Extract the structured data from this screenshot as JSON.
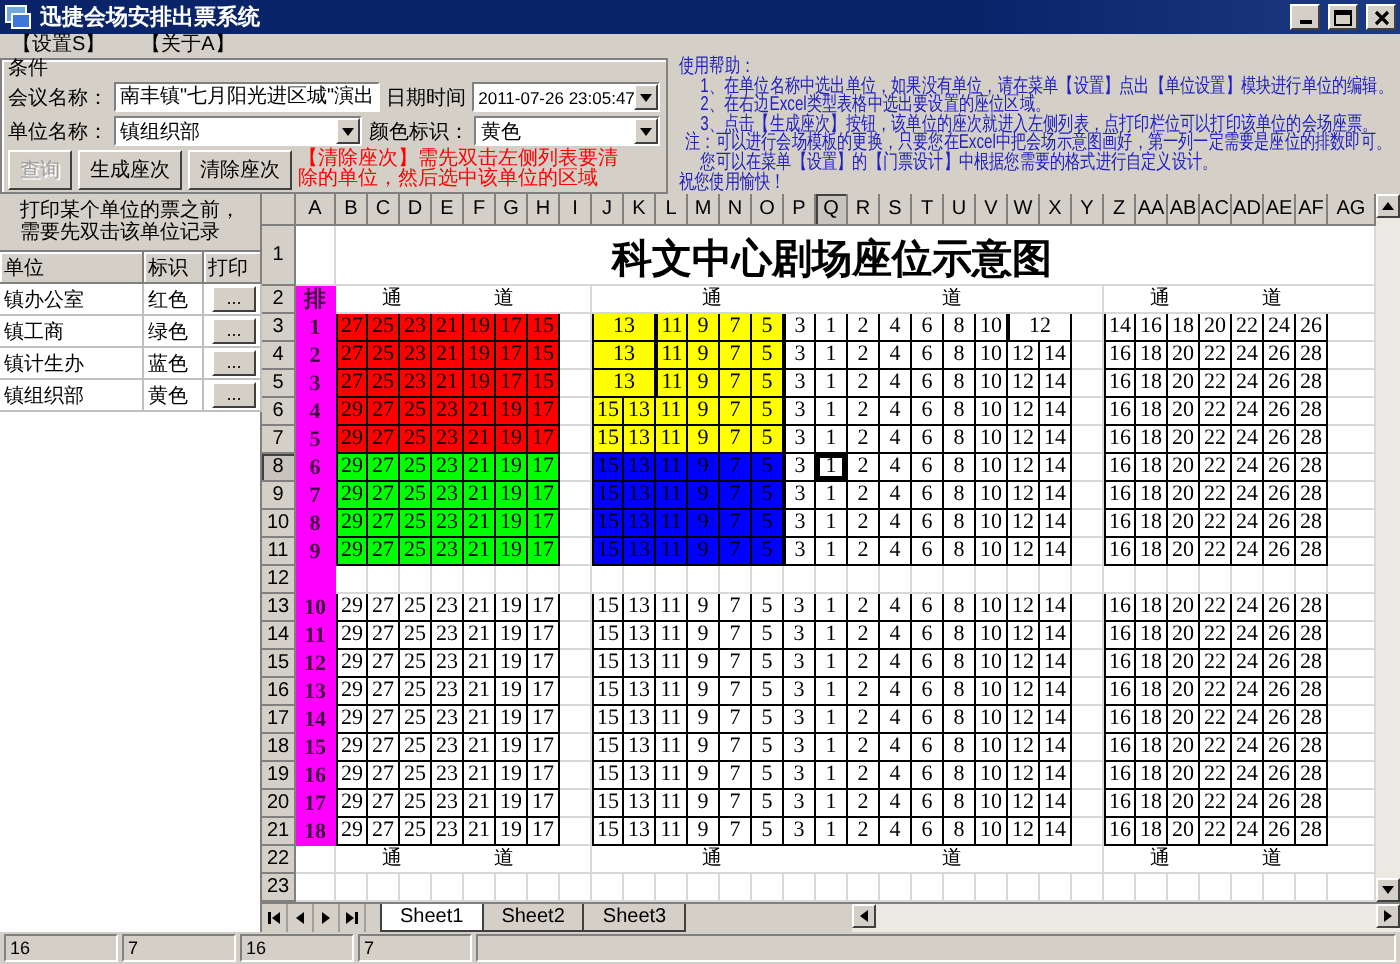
{
  "window": {
    "title": "迅捷会场安排出票系统"
  },
  "menu": [
    "【设置S】",
    "【关于A】"
  ],
  "conditions": {
    "legend": "条件",
    "meeting": {
      "label": "会议名称：",
      "value": "南丰镇\"七月阳光进区城\"演出"
    },
    "datetime": {
      "label": "日期时间",
      "value": "2011-07-26 23:05:47"
    },
    "unit": {
      "label": "单位名称：",
      "value": "镇组织部"
    },
    "color": {
      "label": "颜色标识：",
      "value": "黄色"
    },
    "buttons": [
      {
        "label": "查询",
        "disabled": true
      },
      {
        "label": "生成座次",
        "disabled": false
      },
      {
        "label": "清除座次",
        "disabled": false
      }
    ],
    "note": "【清除座次】需先双击左侧列表要清除的单位，然后选中该单位的区域"
  },
  "help": [
    "使用帮助：",
    "1、在单位名称中选出单位，如果没有单位，请在菜单【设置】点出【单位设置】模块进行单位的编辑。",
    "2、在右边Excel类型表格中选出要设置的座位区域。",
    "3、点击【生成座次】按钮，该单位的座次就进入左侧列表，点打印栏位可以打印该单位的会场座票。",
    "注：可以进行会场模板的更换，只要您在Excel中把会场示意图画好，第一列一定需要是座位的排数即可。",
    "您可以在菜单【设置】的【门票设计】中根据您需要的格式进行自定义设计。",
    "祝您使用愉快！"
  ],
  "unit_list": {
    "hint": "打印某个单位的票之前，需要先双击该单位记录",
    "columns": [
      "单位",
      "标识",
      "打印"
    ],
    "rows": [
      {
        "name": "镇办公室",
        "tag": "红色",
        "print": "..."
      },
      {
        "name": "镇工商",
        "tag": "绿色",
        "print": "..."
      },
      {
        "name": "镇计生办",
        "tag": "蓝色",
        "print": "..."
      },
      {
        "name": "镇组织部",
        "tag": "黄色",
        "print": "..."
      }
    ]
  },
  "sheet": {
    "columns": [
      {
        "label": "A",
        "selected": false
      },
      {
        "label": "B",
        "selected": false
      },
      {
        "label": "C",
        "selected": false
      },
      {
        "label": "D",
        "selected": false
      },
      {
        "label": "E",
        "selected": false
      },
      {
        "label": "F",
        "selected": false
      },
      {
        "label": "G",
        "selected": false
      },
      {
        "label": "H",
        "selected": false
      },
      {
        "label": "I",
        "selected": false
      },
      {
        "label": "J",
        "selected": false
      },
      {
        "label": "K",
        "selected": false
      },
      {
        "label": "L",
        "selected": false
      },
      {
        "label": "M",
        "selected": false
      },
      {
        "label": "N",
        "selected": false
      },
      {
        "label": "O",
        "selected": false
      },
      {
        "label": "P",
        "selected": false
      },
      {
        "label": "Q",
        "selected": true
      },
      {
        "label": "R",
        "selected": false
      },
      {
        "label": "S",
        "selected": false
      },
      {
        "label": "T",
        "selected": false
      },
      {
        "label": "U",
        "selected": false
      },
      {
        "label": "V",
        "selected": false
      },
      {
        "label": "W",
        "selected": false
      },
      {
        "label": "X",
        "selected": false
      },
      {
        "label": "Y",
        "selected": false
      },
      {
        "label": "Z",
        "selected": false
      },
      {
        "label": "AA",
        "selected": false
      },
      {
        "label": "AB",
        "selected": false
      },
      {
        "label": "AC",
        "selected": false
      },
      {
        "label": "AD",
        "selected": false
      },
      {
        "label": "AE",
        "selected": false
      },
      {
        "label": "AF",
        "selected": false
      },
      {
        "label": "AG",
        "selected": false
      }
    ],
    "rows": [
      {
        "kind": "title",
        "n": "1",
        "selected": false,
        "marked": false,
        "text": "科文中心剧场座位示意图"
      },
      {
        "kind": "aisle",
        "n": "2",
        "selected": false,
        "marked": true,
        "label": "排",
        "blocks": [
          [
            "通",
            "道"
          ],
          [
            "通",
            "道"
          ],
          [
            "通",
            "道"
          ]
        ]
      },
      {
        "kind": "seats",
        "n": "3",
        "selected": false,
        "marked": true,
        "label": "1",
        "segments": [
          {
            "kind": "seats",
            "color": "#ff0000",
            "seats": [
              "27",
              "25",
              "23",
              "21",
              "19",
              "17",
              "15"
            ]
          },
          {
            "kind": "gap"
          },
          {
            "kind": "merged",
            "color": "#ffff00",
            "seats": [
              "13"
            ]
          },
          {
            "kind": "seats",
            "color": "#ffff00",
            "seats": [
              "11",
              "9",
              "7",
              "5"
            ]
          },
          {
            "kind": "seats",
            "color": "#ffffff",
            "seats": [
              "3",
              "1",
              "2",
              "4",
              "6",
              "8",
              "10"
            ]
          },
          {
            "kind": "merged",
            "color": "#ffffff",
            "seats": [
              "12"
            ]
          },
          {
            "kind": "gap"
          },
          {
            "kind": "seats",
            "color": "#ffffff",
            "seats": [
              "14",
              "16",
              "18",
              "20",
              "22",
              "24",
              "26"
            ]
          }
        ]
      },
      {
        "kind": "seats",
        "n": "4",
        "selected": false,
        "marked": true,
        "label": "2",
        "segments": [
          {
            "kind": "seats",
            "color": "#ff0000",
            "seats": [
              "27",
              "25",
              "23",
              "21",
              "19",
              "17",
              "15"
            ]
          },
          {
            "kind": "gap"
          },
          {
            "kind": "merged",
            "color": "#ffff00",
            "seats": [
              "13"
            ]
          },
          {
            "kind": "seats",
            "color": "#ffff00",
            "seats": [
              "11",
              "9",
              "7",
              "5"
            ]
          },
          {
            "kind": "seats",
            "color": "#ffffff",
            "seats": [
              "3",
              "1",
              "2",
              "4",
              "6",
              "8",
              "10",
              "12",
              "14"
            ]
          },
          {
            "kind": "gap"
          },
          {
            "kind": "seats",
            "color": "#ffffff",
            "seats": [
              "16",
              "18",
              "20",
              "22",
              "24",
              "26",
              "28"
            ]
          }
        ]
      },
      {
        "kind": "seats",
        "n": "5",
        "selected": false,
        "marked": true,
        "label": "3",
        "segments": [
          {
            "kind": "seats",
            "color": "#ff0000",
            "seats": [
              "27",
              "25",
              "23",
              "21",
              "19",
              "17",
              "15"
            ]
          },
          {
            "kind": "gap"
          },
          {
            "kind": "merged",
            "color": "#ffff00",
            "seats": [
              "13"
            ]
          },
          {
            "kind": "seats",
            "color": "#ffff00",
            "seats": [
              "11",
              "9",
              "7",
              "5"
            ]
          },
          {
            "kind": "seats",
            "color": "#ffffff",
            "seats": [
              "3",
              "1",
              "2",
              "4",
              "6",
              "8",
              "10",
              "12",
              "14"
            ]
          },
          {
            "kind": "gap"
          },
          {
            "kind": "seats",
            "color": "#ffffff",
            "seats": [
              "16",
              "18",
              "20",
              "22",
              "24",
              "26",
              "28"
            ]
          }
        ]
      },
      {
        "kind": "seats",
        "n": "6",
        "selected": false,
        "marked": true,
        "label": "4",
        "segments": [
          {
            "kind": "seats",
            "color": "#ff0000",
            "seats": [
              "29",
              "27",
              "25",
              "23",
              "21",
              "19",
              "17"
            ]
          },
          {
            "kind": "gap"
          },
          {
            "kind": "seats",
            "color": "#ffff00",
            "seats": [
              "15",
              "13",
              "11",
              "9",
              "7",
              "5"
            ]
          },
          {
            "kind": "seats",
            "color": "#ffffff",
            "seats": [
              "3",
              "1",
              "2",
              "4",
              "6",
              "8",
              "10",
              "12",
              "14"
            ]
          },
          {
            "kind": "gap"
          },
          {
            "kind": "seats",
            "color": "#ffffff",
            "seats": [
              "16",
              "18",
              "20",
              "22",
              "24",
              "26",
              "28"
            ]
          }
        ]
      },
      {
        "kind": "seats",
        "n": "7",
        "selected": false,
        "marked": true,
        "label": "5",
        "segments": [
          {
            "kind": "seats",
            "color": "#ff0000",
            "seats": [
              "29",
              "27",
              "25",
              "23",
              "21",
              "19",
              "17"
            ]
          },
          {
            "kind": "gap"
          },
          {
            "kind": "seats",
            "color": "#ffff00",
            "seats": [
              "15",
              "13",
              "11",
              "9",
              "7",
              "5"
            ]
          },
          {
            "kind": "seats",
            "color": "#ffffff",
            "seats": [
              "3",
              "1",
              "2",
              "4",
              "6",
              "8",
              "10",
              "12",
              "14"
            ]
          },
          {
            "kind": "gap"
          },
          {
            "kind": "seats",
            "color": "#ffffff",
            "seats": [
              "16",
              "18",
              "20",
              "22",
              "24",
              "26",
              "28"
            ]
          }
        ]
      },
      {
        "kind": "seats",
        "n": "8",
        "selected": true,
        "marked": true,
        "label": "6",
        "segments": [
          {
            "kind": "seats",
            "color": "#00ff00",
            "seats": [
              "29",
              "27",
              "25",
              "23",
              "21",
              "19",
              "17"
            ]
          },
          {
            "kind": "gap"
          },
          {
            "kind": "seats",
            "color": "#0000ff",
            "seats": [
              "15",
              "13",
              "11",
              "9",
              "7",
              "5"
            ]
          },
          {
            "kind": "seats",
            "color": "#ffffff",
            "seats": [
              "3",
              "1",
              "2",
              "4",
              "6",
              "8",
              "10",
              "12",
              "14"
            ]
          },
          {
            "kind": "gap"
          },
          {
            "kind": "seats",
            "color": "#ffffff",
            "seats": [
              "16",
              "18",
              "20",
              "22",
              "24",
              "26",
              "28"
            ]
          }
        ]
      },
      {
        "kind": "seats",
        "n": "9",
        "selected": false,
        "marked": true,
        "label": "7",
        "segments": [
          {
            "kind": "seats",
            "color": "#00ff00",
            "seats": [
              "29",
              "27",
              "25",
              "23",
              "21",
              "19",
              "17"
            ]
          },
          {
            "kind": "gap"
          },
          {
            "kind": "seats",
            "color": "#0000ff",
            "seats": [
              "15",
              "13",
              "11",
              "9",
              "7",
              "5"
            ]
          },
          {
            "kind": "seats",
            "color": "#ffffff",
            "seats": [
              "3",
              "1",
              "2",
              "4",
              "6",
              "8",
              "10",
              "12",
              "14"
            ]
          },
          {
            "kind": "gap"
          },
          {
            "kind": "seats",
            "color": "#ffffff",
            "seats": [
              "16",
              "18",
              "20",
              "22",
              "24",
              "26",
              "28"
            ]
          }
        ]
      },
      {
        "kind": "seats",
        "n": "10",
        "selected": false,
        "marked": true,
        "label": "8",
        "segments": [
          {
            "kind": "seats",
            "color": "#00ff00",
            "seats": [
              "29",
              "27",
              "25",
              "23",
              "21",
              "19",
              "17"
            ]
          },
          {
            "kind": "gap"
          },
          {
            "kind": "seats",
            "color": "#0000ff",
            "seats": [
              "15",
              "13",
              "11",
              "9",
              "7",
              "5"
            ]
          },
          {
            "kind": "seats",
            "color": "#ffffff",
            "seats": [
              "3",
              "1",
              "2",
              "4",
              "6",
              "8",
              "10",
              "12",
              "14"
            ]
          },
          {
            "kind": "gap"
          },
          {
            "kind": "seats",
            "color": "#ffffff",
            "seats": [
              "16",
              "18",
              "20",
              "22",
              "24",
              "26",
              "28"
            ]
          }
        ]
      },
      {
        "kind": "seats",
        "n": "11",
        "selected": false,
        "marked": true,
        "label": "9",
        "segments": [
          {
            "kind": "seats",
            "color": "#00ff00",
            "seats": [
              "29",
              "27",
              "25",
              "23",
              "21",
              "19",
              "17"
            ]
          },
          {
            "kind": "gap"
          },
          {
            "kind": "seats",
            "color": "#0000ff",
            "seats": [
              "15",
              "13",
              "11",
              "9",
              "7",
              "5"
            ]
          },
          {
            "kind": "seats",
            "color": "#ffffff",
            "seats": [
              "3",
              "1",
              "2",
              "4",
              "6",
              "8",
              "10",
              "12",
              "14"
            ]
          },
          {
            "kind": "gap"
          },
          {
            "kind": "seats",
            "color": "#ffffff",
            "seats": [
              "16",
              "18",
              "20",
              "22",
              "24",
              "26",
              "28"
            ]
          }
        ]
      },
      {
        "kind": "blank",
        "n": "12",
        "selected": false,
        "marked": true
      },
      {
        "kind": "seats",
        "n": "13",
        "selected": false,
        "marked": true,
        "label": "10",
        "segments": [
          {
            "kind": "seats",
            "color": "#ffffff",
            "seats": [
              "29",
              "27",
              "25",
              "23",
              "21",
              "19",
              "17"
            ]
          },
          {
            "kind": "gap"
          },
          {
            "kind": "seats",
            "color": "#ffffff",
            "seats": [
              "15",
              "13",
              "11",
              "9",
              "7",
              "5",
              "3",
              "1",
              "2",
              "4",
              "6",
              "8",
              "10",
              "12",
              "14"
            ]
          },
          {
            "kind": "gap"
          },
          {
            "kind": "seats",
            "color": "#ffffff",
            "seats": [
              "16",
              "18",
              "20",
              "22",
              "24",
              "26",
              "28"
            ]
          }
        ]
      },
      {
        "kind": "seats",
        "n": "14",
        "selected": false,
        "marked": true,
        "label": "11",
        "segments": [
          {
            "kind": "seats",
            "color": "#ffffff",
            "seats": [
              "29",
              "27",
              "25",
              "23",
              "21",
              "19",
              "17"
            ]
          },
          {
            "kind": "gap"
          },
          {
            "kind": "seats",
            "color": "#ffffff",
            "seats": [
              "15",
              "13",
              "11",
              "9",
              "7",
              "5",
              "3",
              "1",
              "2",
              "4",
              "6",
              "8",
              "10",
              "12",
              "14"
            ]
          },
          {
            "kind": "gap"
          },
          {
            "kind": "seats",
            "color": "#ffffff",
            "seats": [
              "16",
              "18",
              "20",
              "22",
              "24",
              "26",
              "28"
            ]
          }
        ]
      },
      {
        "kind": "seats",
        "n": "15",
        "selected": false,
        "marked": true,
        "label": "12",
        "segments": [
          {
            "kind": "seats",
            "color": "#ffffff",
            "seats": [
              "29",
              "27",
              "25",
              "23",
              "21",
              "19",
              "17"
            ]
          },
          {
            "kind": "gap"
          },
          {
            "kind": "seats",
            "color": "#ffffff",
            "seats": [
              "15",
              "13",
              "11",
              "9",
              "7",
              "5",
              "3",
              "1",
              "2",
              "4",
              "6",
              "8",
              "10",
              "12",
              "14"
            ]
          },
          {
            "kind": "gap"
          },
          {
            "kind": "seats",
            "color": "#ffffff",
            "seats": [
              "16",
              "18",
              "20",
              "22",
              "24",
              "26",
              "28"
            ]
          }
        ]
      },
      {
        "kind": "seats",
        "n": "16",
        "selected": false,
        "marked": true,
        "label": "13",
        "segments": [
          {
            "kind": "seats",
            "color": "#ffffff",
            "seats": [
              "29",
              "27",
              "25",
              "23",
              "21",
              "19",
              "17"
            ]
          },
          {
            "kind": "gap"
          },
          {
            "kind": "seats",
            "color": "#ffffff",
            "seats": [
              "15",
              "13",
              "11",
              "9",
              "7",
              "5",
              "3",
              "1",
              "2",
              "4",
              "6",
              "8",
              "10",
              "12",
              "14"
            ]
          },
          {
            "kind": "gap"
          },
          {
            "kind": "seats",
            "color": "#ffffff",
            "seats": [
              "16",
              "18",
              "20",
              "22",
              "24",
              "26",
              "28"
            ]
          }
        ]
      },
      {
        "kind": "seats",
        "n": "17",
        "selected": false,
        "marked": true,
        "label": "14",
        "segments": [
          {
            "kind": "seats",
            "color": "#ffffff",
            "seats": [
              "29",
              "27",
              "25",
              "23",
              "21",
              "19",
              "17"
            ]
          },
          {
            "kind": "gap"
          },
          {
            "kind": "seats",
            "color": "#ffffff",
            "seats": [
              "15",
              "13",
              "11",
              "9",
              "7",
              "5",
              "3",
              "1",
              "2",
              "4",
              "6",
              "8",
              "10",
              "12",
              "14"
            ]
          },
          {
            "kind": "gap"
          },
          {
            "kind": "seats",
            "color": "#ffffff",
            "seats": [
              "16",
              "18",
              "20",
              "22",
              "24",
              "26",
              "28"
            ]
          }
        ]
      },
      {
        "kind": "seats",
        "n": "18",
        "selected": false,
        "marked": true,
        "label": "15",
        "segments": [
          {
            "kind": "seats",
            "color": "#ffffff",
            "seats": [
              "29",
              "27",
              "25",
              "23",
              "21",
              "19",
              "17"
            ]
          },
          {
            "kind": "gap"
          },
          {
            "kind": "seats",
            "color": "#ffffff",
            "seats": [
              "15",
              "13",
              "11",
              "9",
              "7",
              "5",
              "3",
              "1",
              "2",
              "4",
              "6",
              "8",
              "10",
              "12",
              "14"
            ]
          },
          {
            "kind": "gap"
          },
          {
            "kind": "seats",
            "color": "#ffffff",
            "seats": [
              "16",
              "18",
              "20",
              "22",
              "24",
              "26",
              "28"
            ]
          }
        ]
      },
      {
        "kind": "seats",
        "n": "19",
        "selected": false,
        "marked": true,
        "label": "16",
        "segments": [
          {
            "kind": "seats",
            "color": "#ffffff",
            "seats": [
              "29",
              "27",
              "25",
              "23",
              "21",
              "19",
              "17"
            ]
          },
          {
            "kind": "gap"
          },
          {
            "kind": "seats",
            "color": "#ffffff",
            "seats": [
              "15",
              "13",
              "11",
              "9",
              "7",
              "5",
              "3",
              "1",
              "2",
              "4",
              "6",
              "8",
              "10",
              "12",
              "14"
            ]
          },
          {
            "kind": "gap"
          },
          {
            "kind": "seats",
            "color": "#ffffff",
            "seats": [
              "16",
              "18",
              "20",
              "22",
              "24",
              "26",
              "28"
            ]
          }
        ]
      },
      {
        "kind": "seats",
        "n": "20",
        "selected": false,
        "marked": true,
        "label": "17",
        "segments": [
          {
            "kind": "seats",
            "color": "#ffffff",
            "seats": [
              "29",
              "27",
              "25",
              "23",
              "21",
              "19",
              "17"
            ]
          },
          {
            "kind": "gap"
          },
          {
            "kind": "seats",
            "color": "#ffffff",
            "seats": [
              "15",
              "13",
              "11",
              "9",
              "7",
              "5",
              "3",
              "1",
              "2",
              "4",
              "6",
              "8",
              "10",
              "12",
              "14"
            ]
          },
          {
            "kind": "gap"
          },
          {
            "kind": "seats",
            "color": "#ffffff",
            "seats": [
              "16",
              "18",
              "20",
              "22",
              "24",
              "26",
              "28"
            ]
          }
        ]
      },
      {
        "kind": "seats",
        "n": "21",
        "selected": false,
        "marked": true,
        "label": "18",
        "segments": [
          {
            "kind": "seats",
            "color": "#ffffff",
            "seats": [
              "29",
              "27",
              "25",
              "23",
              "21",
              "19",
              "17"
            ]
          },
          {
            "kind": "gap"
          },
          {
            "kind": "seats",
            "color": "#ffffff",
            "seats": [
              "15",
              "13",
              "11",
              "9",
              "7",
              "5",
              "3",
              "1",
              "2",
              "4",
              "6",
              "8",
              "10",
              "12",
              "14"
            ]
          },
          {
            "kind": "gap"
          },
          {
            "kind": "seats",
            "color": "#ffffff",
            "seats": [
              "16",
              "18",
              "20",
              "22",
              "24",
              "26",
              "28"
            ]
          }
        ]
      },
      {
        "kind": "aisle",
        "n": "22",
        "selected": false,
        "marked": false,
        "blocks": [
          [
            "通",
            "道"
          ],
          [
            "通",
            "道"
          ],
          [
            "通",
            "道"
          ]
        ]
      },
      {
        "kind": "blank",
        "n": "23",
        "selected": false,
        "marked": false
      }
    ],
    "tabs": [
      {
        "label": "Sheet1",
        "selected": true
      },
      {
        "label": "Sheet2",
        "selected": false
      },
      {
        "label": "Sheet3",
        "selected": false
      }
    ]
  },
  "status_bar": [
    "16",
    "7",
    "16",
    "7"
  ]
}
